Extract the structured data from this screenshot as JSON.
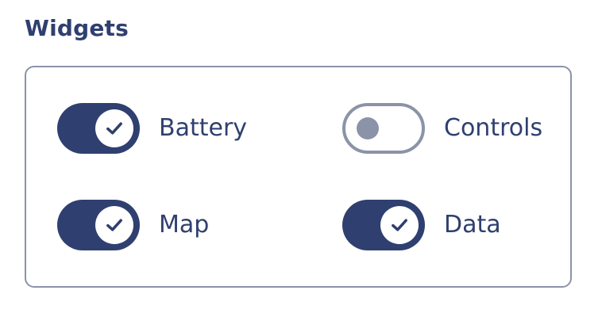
{
  "section": {
    "title": "Widgets"
  },
  "widgets": [
    {
      "label": "Battery",
      "enabled": true
    },
    {
      "label": "Controls",
      "enabled": false
    },
    {
      "label": "Map",
      "enabled": true
    },
    {
      "label": "Data",
      "enabled": true
    }
  ],
  "colors": {
    "accent": "#2f3f6f",
    "muted": "#8b93a8",
    "background": "#ffffff"
  },
  "icons": {
    "enabled_knob": "check-icon",
    "disabled_knob": "toggle-knob"
  }
}
